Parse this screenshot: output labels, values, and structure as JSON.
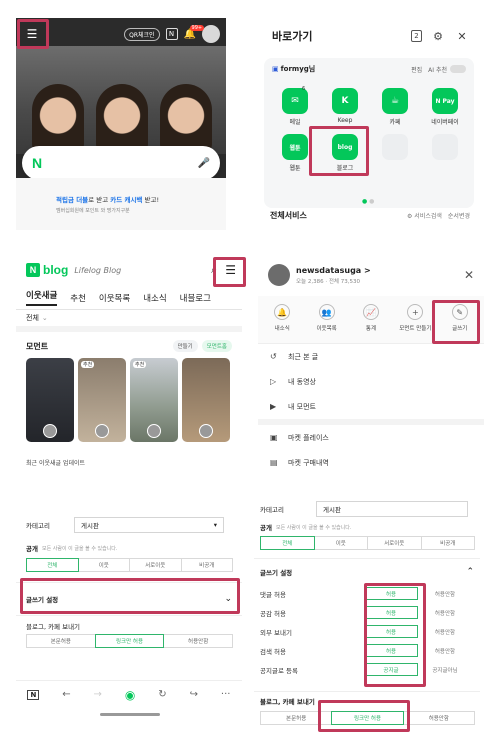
{
  "q1": {
    "topbar": {
      "qr": "QR체크인",
      "n": "N",
      "badge": "99+"
    },
    "ad": {
      "line1_a": "적립금 더블",
      "line1_b": "로 받고 ",
      "line1_c": "카드 캐시백",
      "line1_d": " 받고!",
      "line2": "멤버십회원에 포인트 와 명가지구분"
    }
  },
  "q2": {
    "title": "바로가기",
    "tab_count": "2",
    "profile": "formyg님",
    "edit": "편집",
    "ai": "AI 추천",
    "apps": [
      {
        "label": "메일",
        "glyph": "✉"
      },
      {
        "label": "Keep",
        "glyph": "K"
      },
      {
        "label": "카페",
        "glyph": "☕"
      },
      {
        "label": "네이버페이",
        "glyph": "N Pay"
      },
      {
        "label": "웹툰",
        "glyph": "웹툰"
      },
      {
        "label": "블로그",
        "glyph": "blog"
      }
    ],
    "mail_badge": "6",
    "all_services": "전체서비스",
    "search": "서비스검색",
    "order": "순서변경"
  },
  "q3": {
    "logo_n": "N",
    "logo_blog": "blog",
    "logo_lifelog": "Lifelog Blog",
    "tabs": [
      "이웃새글",
      "추천",
      "이웃목록",
      "내소식",
      "내블로그"
    ],
    "filter": "전체",
    "moment": "모먼트",
    "btn_make": "만들기",
    "btn_moment": "모먼트홈",
    "thumb_badge": "추천",
    "footer": "최근 이웃새글 업데이트"
  },
  "q4": {
    "name": "newsdatasuga >",
    "stats": "오늘 2,386 · 전체 73,530",
    "icons": [
      {
        "label": "내소식",
        "glyph": "🔔"
      },
      {
        "label": "이웃목록",
        "glyph": "👥"
      },
      {
        "label": "통계",
        "glyph": "📈"
      },
      {
        "label": "모먼트 만들기",
        "glyph": "+"
      },
      {
        "label": "글쓰기",
        "glyph": "✎"
      }
    ],
    "menu": [
      {
        "label": "최근 본 글",
        "glyph": "↺"
      },
      {
        "label": "내 동영상",
        "glyph": "▷"
      },
      {
        "label": "내 모먼트",
        "glyph": "▶"
      },
      {
        "label": "마켓 플레이스",
        "glyph": "▣"
      },
      {
        "label": "마켓 구매내역",
        "glyph": "▤"
      }
    ]
  },
  "q5": {
    "category_label": "카테고리",
    "category_value": "게시판",
    "public_label": "공개",
    "public_hint": "모든 사람이 이 글을 볼 수 있습니다.",
    "public_options": [
      "전체",
      "이웃",
      "서로이웃",
      "비공개"
    ],
    "write_settings": "글쓰기 설정",
    "share_label": "블로그, 카페 보내기",
    "share_options": [
      "본문허용",
      "링크만 허용",
      "허용안함"
    ],
    "nav_icons": [
      "N",
      "←",
      "→",
      "◉",
      "↻",
      "↪",
      "···"
    ]
  },
  "q6": {
    "category_label": "카테고리",
    "category_value": "게시판",
    "public_label": "공개",
    "public_hint": "모든 사람이 이 글을 볼 수 있습니다.",
    "public_options": [
      "전체",
      "이웃",
      "서로이웃",
      "비공개"
    ],
    "write_settings": "글쓰기 설정",
    "rows": [
      {
        "label": "댓글 허용",
        "a": "허용",
        "b": "허용안함"
      },
      {
        "label": "공감 허용",
        "a": "허용",
        "b": "허용안함"
      },
      {
        "label": "외부 보내기",
        "a": "허용",
        "b": "허용안함"
      },
      {
        "label": "검색 허용",
        "a": "허용",
        "b": "허용안함"
      },
      {
        "label": "공지글로 등록",
        "a": "공지글",
        "b": "공지글아님"
      }
    ],
    "share_label": "블로그, 카페 보내기",
    "share_options": [
      "본문허용",
      "링크만 허용",
      "허용안함"
    ]
  },
  "colors": {
    "naver_green": "#03c75a",
    "highlight": "#c0395a",
    "toggle_green": "#2fb56b"
  }
}
